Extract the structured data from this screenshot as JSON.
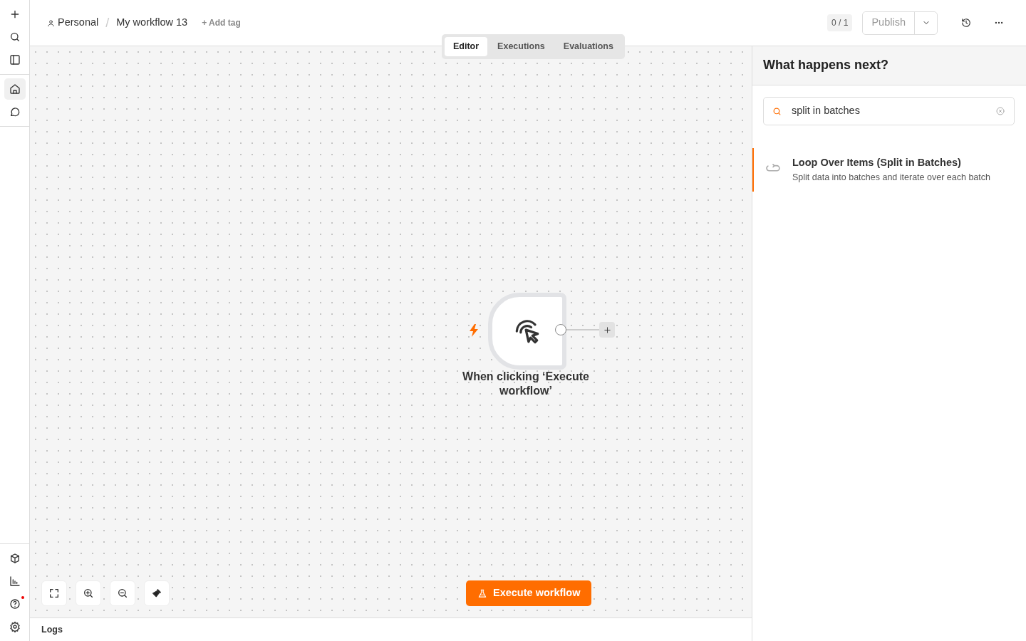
{
  "sidebar": {
    "top_items": [
      {
        "kind": "plus",
        "selected": false
      },
      {
        "kind": "search",
        "selected": false
      },
      {
        "kind": "panel",
        "selected": false
      }
    ],
    "nav_items": [
      {
        "kind": "home",
        "selected": true
      },
      {
        "kind": "chat",
        "selected": false
      }
    ],
    "bottom_items": [
      {
        "kind": "cube",
        "selected": false,
        "notification": false
      },
      {
        "kind": "chart",
        "selected": false,
        "notification": false
      },
      {
        "kind": "help",
        "selected": false,
        "notification": true
      },
      {
        "kind": "settings",
        "selected": false,
        "notification": false
      }
    ]
  },
  "header": {
    "project": "Personal",
    "separator": "/",
    "workflow_name": "My workflow 13",
    "add_tag": "+ Add tag",
    "counter": "0 / 1",
    "publish": {
      "label": "Publish",
      "disabled": true
    }
  },
  "tabs": [
    {
      "label": "Editor",
      "selected": true
    },
    {
      "label": "Executions",
      "selected": false
    },
    {
      "label": "Evaluations",
      "selected": false
    }
  ],
  "canvas": {
    "node": {
      "label": "When clicking ‘Execute workflow’",
      "trigger": true
    },
    "execute_button": "Execute workflow"
  },
  "logs": {
    "label": "Logs"
  },
  "panel": {
    "title": "What happens next?",
    "search": {
      "value": "split in batches"
    },
    "results": [
      {
        "title": "Loop Over Items (Split in Batches)",
        "description": "Split data into batches and iterate over each batch",
        "selected": true
      }
    ]
  }
}
